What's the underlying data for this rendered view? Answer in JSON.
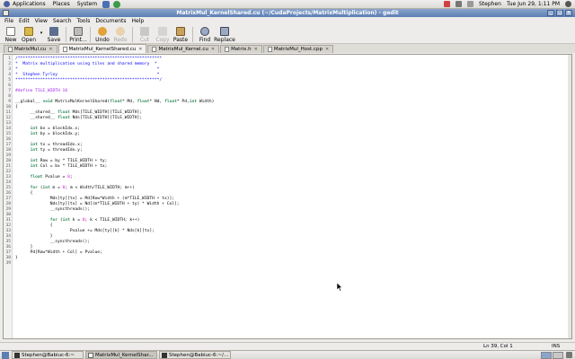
{
  "top_panel": {
    "menus": [
      "Applications",
      "Places",
      "System"
    ],
    "user": "Stephen",
    "clock": "Tue Jun 29,  1:11 PM"
  },
  "window": {
    "title": "MatrixMul_KernelShared.cu (~/CudaProjects/MatrixMultiplication) - gedit"
  },
  "menubar": [
    "File",
    "Edit",
    "View",
    "Search",
    "Tools",
    "Documents",
    "Help"
  ],
  "toolbar": {
    "new": "New",
    "open": "Open",
    "save": "Save",
    "print": "Print...",
    "undo": "Undo",
    "redo": "Redo",
    "cut": "Cut",
    "copy": "Copy",
    "paste": "Paste",
    "find": "Find",
    "replace": "Replace"
  },
  "tabs": [
    {
      "label": "MatrixMul.cu",
      "active": false
    },
    {
      "label": "MatrixMul_KernelShared.cu",
      "active": true
    },
    {
      "label": "MatrixMul_Kernel.cu",
      "active": false
    },
    {
      "label": "Matrix.h",
      "active": false
    },
    {
      "label": "MatrixMul_Host.cpp",
      "active": false
    }
  ],
  "code_lines": [
    {
      "n": "1",
      "t": "/**********************************************************",
      "k": "comment"
    },
    {
      "n": "2",
      "t": "*  Matrix multiplication using tiles and shared memory  *",
      "k": "comment"
    },
    {
      "n": "3",
      "t": "*                                                        *",
      "k": "comment"
    },
    {
      "n": "4",
      "t": "*  Stephen Tyrloy                                        *",
      "k": "comment"
    },
    {
      "n": "5",
      "t": "**********************************************************/",
      "k": "comment"
    },
    {
      "n": "6",
      "t": "",
      "k": "plain"
    },
    {
      "n": "7",
      "t": "#define TILE_WIDTH 16",
      "k": "preproc"
    },
    {
      "n": "8",
      "t": "",
      "k": "plain"
    },
    {
      "n": "9",
      "t": "__global__ void MatrixMulKernelShared(float* Md, float* Nd, float* Pd,int Width)",
      "k": "plain"
    },
    {
      "n": "10",
      "t": "{",
      "k": "plain"
    },
    {
      "n": "11",
      "t": "      __shared__ float Mds[TILE_WIDTH][TILE_WIDTH];",
      "k": "plain"
    },
    {
      "n": "12",
      "t": "      __shared__ float Nds[TILE_WIDTH][TILE_WIDTH];",
      "k": "plain"
    },
    {
      "n": "13",
      "t": "",
      "k": "plain"
    },
    {
      "n": "14",
      "t": "      int bx = blockIdx.x;",
      "k": "plain"
    },
    {
      "n": "15",
      "t": "      int by = blockIdx.y;",
      "k": "plain"
    },
    {
      "n": "16",
      "t": "",
      "k": "plain"
    },
    {
      "n": "17",
      "t": "      int tx = threadIdx.x;",
      "k": "plain"
    },
    {
      "n": "18",
      "t": "      int ty = threadIdx.y;",
      "k": "plain"
    },
    {
      "n": "19",
      "t": "",
      "k": "plain"
    },
    {
      "n": "20",
      "t": "      int Row = by * TILE_WIDTH + ty;",
      "k": "plain"
    },
    {
      "n": "21",
      "t": "      int Col = bx * TILE_WIDTH + tx;",
      "k": "plain"
    },
    {
      "n": "22",
      "t": "",
      "k": "plain"
    },
    {
      "n": "23",
      "t": "      float Pvalue = 0;",
      "k": "plain"
    },
    {
      "n": "24",
      "t": "",
      "k": "plain"
    },
    {
      "n": "25",
      "t": "      for (int m = 0; m < Width/TILE_WIDTH; m++)",
      "k": "plain"
    },
    {
      "n": "26",
      "t": "      {",
      "k": "plain"
    },
    {
      "n": "27",
      "t": "              Mds[ty][tx] = Md[Row*Width + (m*TILE_WIDTH + tx)];",
      "k": "plain"
    },
    {
      "n": "28",
      "t": "              Nds[ty][tx] = Nd[(m*TILE_WIDTH + ty) * Width + Col];",
      "k": "plain"
    },
    {
      "n": "29",
      "t": "              __syncthreads();",
      "k": "plain"
    },
    {
      "n": "30",
      "t": "",
      "k": "plain"
    },
    {
      "n": "31",
      "t": "              for (int k = 0; k < TILE_WIDTH; k++)",
      "k": "plain"
    },
    {
      "n": "32",
      "t": "              {",
      "k": "plain"
    },
    {
      "n": "33",
      "t": "                      Pvalue += Mds[ty][k] * Nds[k][tx];",
      "k": "plain"
    },
    {
      "n": "34",
      "t": "              }",
      "k": "plain"
    },
    {
      "n": "35",
      "t": "              __syncthreads();",
      "k": "plain"
    },
    {
      "n": "36",
      "t": "      }",
      "k": "plain"
    },
    {
      "n": "37",
      "t": "      Pd[Row*Width + Col] = Pvalue;",
      "k": "plain"
    },
    {
      "n": "38",
      "t": "}",
      "k": "plain"
    },
    {
      "n": "39",
      "t": "",
      "k": "plain"
    }
  ],
  "statusbar": {
    "position": "Ln 39, Col 1",
    "mode": "INS"
  },
  "taskbar": [
    {
      "label": "Stephen@Babiuc-6:~",
      "icon": "terminal-icon",
      "active": false
    },
    {
      "label": "MatrixMul_KernelShar...",
      "icon": "gedit-icon",
      "active": true
    },
    {
      "label": "Stephen@Babiuc-6:~/...",
      "icon": "terminal-icon",
      "active": false
    }
  ],
  "colors": {
    "comment": "#0000ff",
    "preprocessor": "#a020f0",
    "keyword": "#2e8b57",
    "number": "#ff00ff",
    "titlebar": "#5b7eb3"
  }
}
